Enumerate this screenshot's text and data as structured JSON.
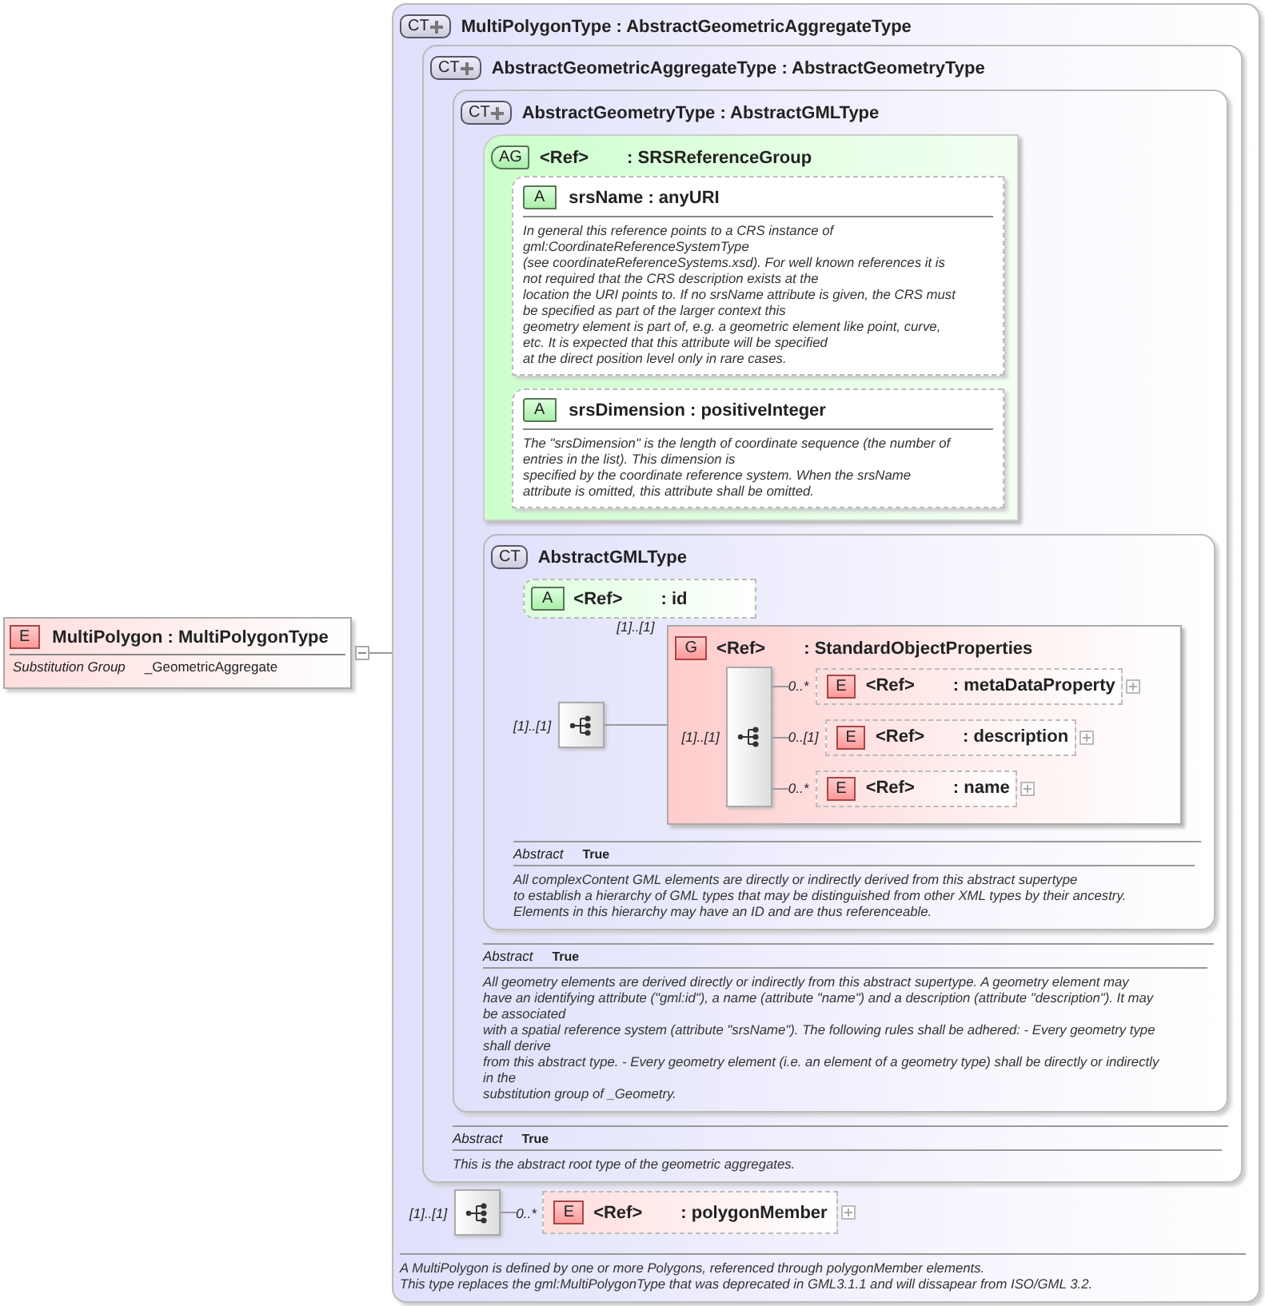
{
  "element": {
    "badge": "E",
    "title": "MultiPolygon : MultiPolygonType",
    "expanded": true,
    "optional": false,
    "prop_label": "Substitution Group",
    "prop_value": "_GeometricAggregate"
  },
  "root": {
    "badge": "CT",
    "extension": true,
    "title": "MultiPolygonType : AbstractGeometricAggregateType",
    "aggregate": {
      "badge": "CT",
      "extension": true,
      "title": "AbstractGeometricAggregateType : AbstractGeometryType",
      "geometry": {
        "badge": "CT",
        "extension": true,
        "title": "AbstractGeometryType : AbstractGMLType",
        "attribute_group": {
          "badge": "AG",
          "ref": "<Ref>",
          "name": ": SRSReferenceGroup",
          "attributes": [
            {
              "badge": "A",
              "optional": true,
              "title": "srsName : anyURI",
              "doc": "In general this reference points to a CRS instance of\ngml:CoordinateReferenceSystemType\n(see coordinateReferenceSystems.xsd). For well known references it is\nnot required that the CRS description exists at the\nlocation the URI points to. If no srsName attribute is given, the CRS must\nbe specified as part of the larger context this\ngeometry element is part of, e.g. a geometric element like point, curve,\netc. It is expected that this attribute will be specified\nat the direct position level only in rare cases."
            },
            {
              "badge": "A",
              "optional": true,
              "title": "srsDimension : positiveInteger",
              "doc": "The \"srsDimension\" is the length of coordinate sequence (the number of\nentries in the list). This dimension is\nspecified by the coordinate reference system. When the srsName\nattribute is omitted, this attribute shall be omitted."
            }
          ]
        },
        "gml": {
          "badge": "CT",
          "extension": false,
          "title": "AbstractGMLType",
          "id_attribute": {
            "badge": "A",
            "optional": true,
            "ref": "<Ref>",
            "name": ": id"
          },
          "sequence_occurs": "[1]..[1]",
          "group_occurs": "[1]..[1]",
          "group": {
            "badge": "G",
            "ref": "<Ref>",
            "name": ": StandardObjectProperties",
            "sequence_occurs": "[1]..[1]",
            "elements": [
              {
                "occurs": "0..*",
                "badge": "E",
                "optional": true,
                "expanded": false,
                "ref": "<Ref>",
                "name": ": metaDataProperty"
              },
              {
                "occurs": "0..[1]",
                "badge": "E",
                "optional": true,
                "expanded": false,
                "ref": "<Ref>",
                "name": ": description"
              },
              {
                "occurs": "0..*",
                "badge": "E",
                "optional": true,
                "expanded": false,
                "ref": "<Ref>",
                "name": ": name"
              }
            ]
          },
          "abstract_label": "Abstract",
          "abstract_value": "True",
          "doc": "All complexContent GML elements are directly or indirectly derived from this abstract supertype\nto establish a hierarchy of GML types that may be distinguished from other XML types by their ancestry.\nElements in this hierarchy may have an ID and are thus referenceable."
        },
        "abstract_label": "Abstract",
        "abstract_value": "True",
        "doc": "All geometry elements are derived directly or indirectly from this abstract supertype. A geometry element may\nhave an identifying attribute (\"gml:id\"), a name (attribute \"name\") and a description (attribute \"description\"). It may\nbe associated\nwith a spatial reference system (attribute \"srsName\"). The following rules shall be adhered: - Every geometry type\nshall derive\nfrom this abstract type. - Every geometry element (i.e. an element of a geometry type) shall be directly or indirectly\nin the\nsubstitution group of _Geometry."
      },
      "abstract_label": "Abstract",
      "abstract_value": "True",
      "doc": "This is the abstract root type of the geometric aggregates."
    },
    "sequence_occurs": "[1]..[1]",
    "member": {
      "occurs": "0..*",
      "badge": "E",
      "optional": true,
      "expanded": false,
      "ref": "<Ref>",
      "name": ": polygonMember"
    },
    "doc": "A MultiPolygon is defined by one or more Polygons, referenced through polygonMember elements.\nThis type replaces the gml:MultiPolygonType that was deprecated in GML3.1.1 and will dissapear from ISO/GML 3.2."
  }
}
